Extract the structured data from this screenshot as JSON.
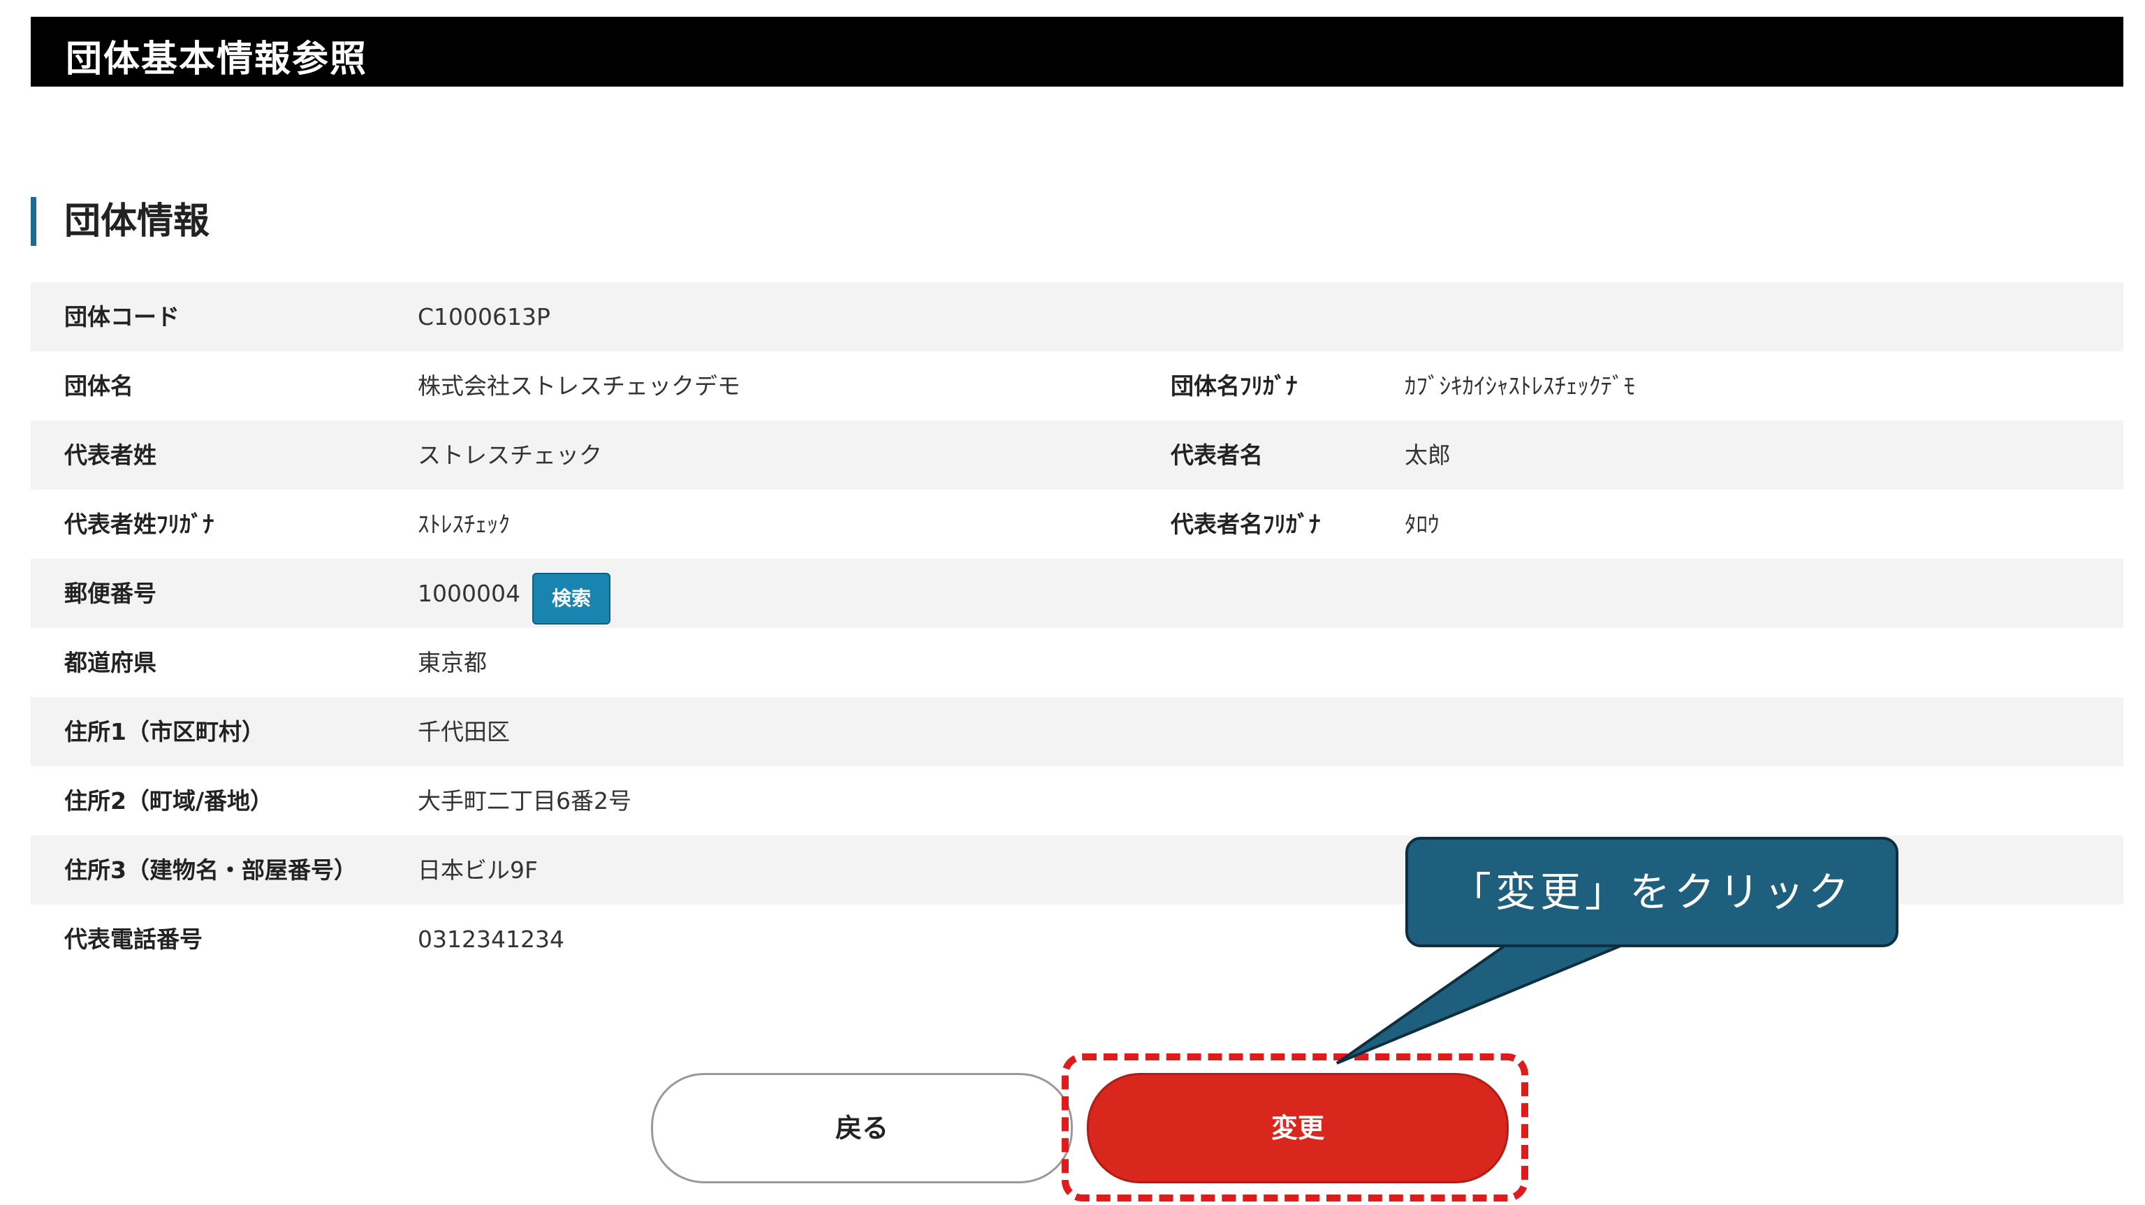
{
  "header": {
    "title": "団体基本情報参照"
  },
  "section": {
    "title": "団体情報"
  },
  "rows": [
    {
      "label": "団体コード",
      "value": "C1000613P"
    },
    {
      "label": "団体名",
      "value": "株式会社ストレスチェックデモ",
      "label2": "団体名ﾌﾘｶﾞﾅ",
      "value2": "ｶﾌﾞｼｷｶｲｼｬｽﾄﾚｽﾁｪｯｸﾃﾞﾓ"
    },
    {
      "label": "代表者姓",
      "value": "ストレスチェック",
      "label2": "代表者名",
      "value2": "太郎"
    },
    {
      "label": "代表者姓ﾌﾘｶﾞﾅ",
      "value": "ｽﾄﾚｽﾁｪｯｸ",
      "label2": "代表者名ﾌﾘｶﾞﾅ",
      "value2": "ﾀﾛｳ"
    },
    {
      "label": "郵便番号",
      "value": "1000004",
      "button": "検索"
    },
    {
      "label": "都道府県",
      "value": "東京都"
    },
    {
      "label": "住所1（市区町村）",
      "value": "千代田区"
    },
    {
      "label": "住所2（町域/番地）",
      "value": "大手町二丁目6番2号"
    },
    {
      "label": "住所3（建物名・部屋番号）",
      "value": "日本ビル9F"
    },
    {
      "label": "代表電話番号",
      "value": "0312341234"
    }
  ],
  "actions": {
    "back": "戻る",
    "change": "変更"
  },
  "callout": {
    "text": "「変更」をクリック"
  },
  "colors": {
    "accent": "#1a6e96",
    "danger": "#d9271e",
    "callout": "#1e5f7e"
  }
}
